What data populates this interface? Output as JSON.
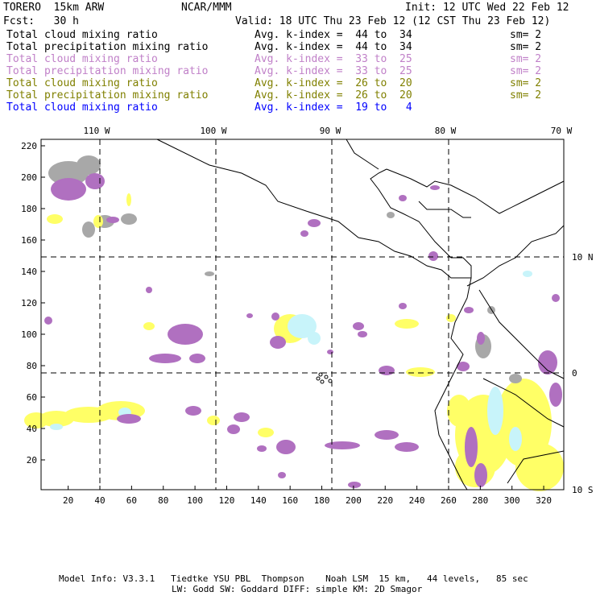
{
  "header": {
    "model": "TORERO  15km ARW",
    "org": "NCAR/MMM",
    "init": "Init: 12 UTC Wed 22 Feb 12",
    "fcst": "Fcst:   30 h",
    "valid": "Valid: 18 UTC Thu 23 Feb 12 (12 CST Thu 23 Feb 12)"
  },
  "legend": [
    {
      "field": "Total cloud mixing ratio",
      "range": "Avg. k-index =  44 to  34",
      "sm": "sm= 2",
      "color": "#000000"
    },
    {
      "field": "Total precipitation mixing ratio",
      "range": "Avg. k-index =  44 to  34",
      "sm": "sm= 2",
      "color": "#000000"
    },
    {
      "field": "Total cloud mixing ratio",
      "range": "Avg. k-index =  33 to  25",
      "sm": "sm= 2",
      "color": "#c080c8"
    },
    {
      "field": "Total precipitation mixing ratio",
      "range": "Avg. k-index =  33 to  25",
      "sm": "sm= 2",
      "color": "#c080c8"
    },
    {
      "field": "Total cloud mixing ratio",
      "range": "Avg. k-index =  26 to  20",
      "sm": "sm= 2",
      "color": "#808000"
    },
    {
      "field": "Total precipitation mixing ratio",
      "range": "Avg. k-index =  26 to  20",
      "sm": "sm= 2",
      "color": "#808000"
    },
    {
      "field": "Total cloud mixing ratio",
      "range": "Avg. k-index =  19 to   4",
      "sm": "",
      "color": "#0000ff"
    }
  ],
  "map": {
    "lon_labels": [
      "110 W",
      "100 W",
      "90 W",
      "80 W",
      "70 W"
    ],
    "lat_labels": [
      "10 N",
      "0",
      "10 S"
    ],
    "x_ticks": [
      "20",
      "40",
      "60",
      "80",
      "100",
      "120",
      "140",
      "160",
      "180",
      "200",
      "220",
      "240",
      "260",
      "280",
      "300",
      "320"
    ],
    "y_ticks": [
      "20",
      "40",
      "60",
      "80",
      "100",
      "120",
      "140",
      "160",
      "180",
      "200",
      "220"
    ],
    "colors": {
      "gray": "#a8a8a8",
      "purple": "#b070c0",
      "yellow": "#ffff66",
      "cyan": "#c8f4fa"
    }
  },
  "footer": {
    "line1": "Model Info: V3.3.1   Tiedtke YSU PBL  Thompson    Noah LSM  15 km,   44 levels,   85 sec",
    "line2": "LW: Godd SW: Goddard DIFF: simple KM: 2D Smagor"
  }
}
